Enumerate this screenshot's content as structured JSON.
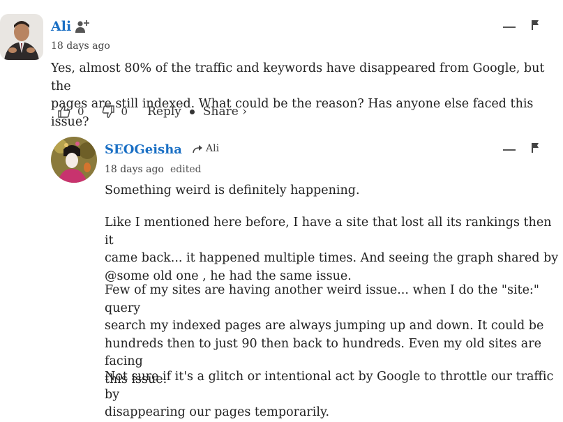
{
  "comments": [
    {
      "author": "Ali",
      "date": "18 days ago",
      "text": "Yes, almost 80% of the traffic and keywords have disappeared from Google, but the pages are still indexed. What could be the reason? Has anyone else faced this issue?",
      "text_lines": [
        "Yes, almost 80% of the traffic and keywords have disappeared from Google, but the",
        "pages are still indexed. What could be the reason? Has anyone else faced this issue?"
      ],
      "likes": "0",
      "dislikes": "0",
      "reply_label": "Reply",
      "share_label": "Share ›"
    },
    {
      "author": "SEOGeisha",
      "replying_to": "Ali",
      "date": "18 days ago",
      "edited_label": "edited",
      "paragraphs": [
        [
          "Something weird is definitely happening."
        ],
        [
          "Like I mentioned here before, I have a site that lost all its rankings then it",
          "came back... it happened multiple times. And seeing the graph shared by",
          "@some old one , he had the same issue."
        ],
        [
          "Few of my sites are having another weird issue... when I do the \"site:\" query",
          "search my indexed pages are always jumping up and down. It could be",
          "hundreds then to just 90 then back to hundreds. Even my old sites are facing",
          "this issue."
        ],
        [
          "Not sure if it's a glitch or intentional act by Google to throttle our traffic by",
          "disappearing our pages temporarily."
        ]
      ]
    }
  ],
  "colors": {
    "author_link": "#1a6fc4",
    "text": "#222222",
    "muted": "#444444"
  }
}
